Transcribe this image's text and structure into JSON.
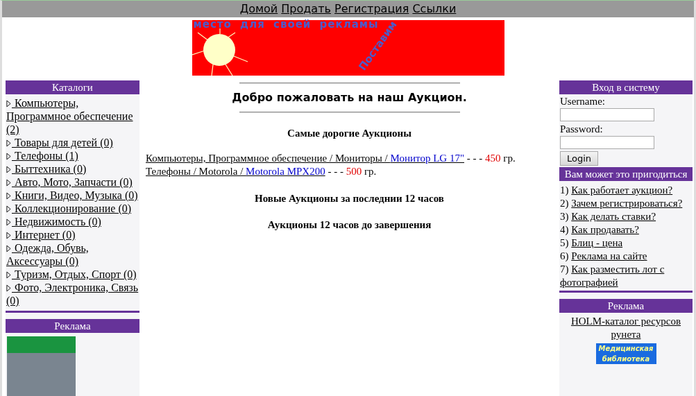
{
  "nav": [
    "Домой",
    "Продать",
    "Регистрация",
    "Ссылки"
  ],
  "banner": {
    "headline": "место для своей рекламы",
    "slogan": "Поставим"
  },
  "catalog": {
    "title": "Каталоги",
    "items": [
      {
        "label": "Компьютеры, Программное обеспечение (2)"
      },
      {
        "label": "Товары для детей (0)"
      },
      {
        "label": "Телефоны (1)"
      },
      {
        "label": "Быттехника (0)"
      },
      {
        "label": "Авто, Мото, Запчасти (0)"
      },
      {
        "label": "Книги, Видео, Музыка (0)"
      },
      {
        "label": "Коллекционирование (0)"
      },
      {
        "label": "Недвижимость (0)"
      },
      {
        "label": "Интернет (0)"
      },
      {
        "label": "Одежда, Обувь, Аксессуары (0)"
      },
      {
        "label": "Туризм, Отдых, Спорт (0)"
      },
      {
        "label": "Фото, Электроника, Связь (0)"
      }
    ]
  },
  "left_ad": {
    "title": "Реклама"
  },
  "welcome": "Добро пожаловать на наш Аукцион.",
  "sections": [
    {
      "title": "Самые дорогие Аукционы",
      "rows": [
        {
          "category": "Компьютеры, Программное обеспечение / Мониторы / ",
          "item": "Монитор LG 17\"",
          "dashes": " - - - ",
          "price": "450",
          "currency": " гр."
        },
        {
          "category": "Телефоны / Motorola / ",
          "item": "Motorola MPX200",
          "dashes": " - - - ",
          "price": "500",
          "currency": " гр."
        }
      ]
    },
    {
      "title": "Новые Аукционы за последнии 12 часов"
    },
    {
      "title": "Аукционы 12 часов до завершения"
    }
  ],
  "login": {
    "title": "Вход в систему",
    "username_label": "Username:",
    "password_label": "Password:",
    "button": "Login"
  },
  "help": {
    "title": "Вам может это пригодиться",
    "items": [
      {
        "number": "1) ",
        "link": "Как работает аукцион?"
      },
      {
        "number": "2) ",
        "link": "Зачем регистрироваться?"
      },
      {
        "number": "3) ",
        "link": "Как делать ставки?"
      },
      {
        "number": "4) ",
        "link": "Как продавать?"
      },
      {
        "number": "5) ",
        "link": "Блиц - цена"
      },
      {
        "number": "6) ",
        "link": "Реклама на сайте"
      },
      {
        "number": "7) ",
        "link": "Как разместить лот с фотографией"
      }
    ]
  },
  "right_ad": {
    "title": "Реклама",
    "link": "HOLM-каталог ресурсов рунета",
    "badge_line1": "Медицинская",
    "badge_line2": "библиотека"
  }
}
